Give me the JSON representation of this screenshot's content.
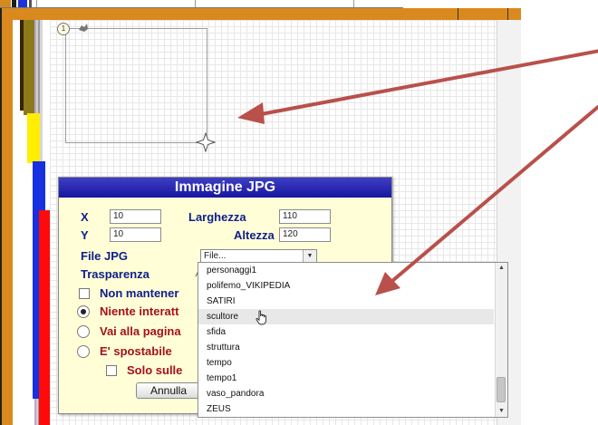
{
  "dialog": {
    "title": "Immagine JPG",
    "x_label": "X",
    "x_value": "10",
    "y_label": "Y",
    "y_value": "10",
    "width_label": "Larghezza",
    "width_value": "110",
    "height_label": "Altezza",
    "height_value": "120",
    "file_label": "File JPG",
    "file_selected": "File...",
    "transparency_label": "Trasparenza",
    "keep_ratio_label": "Non mantener",
    "no_interaction_label": "Niente interatt",
    "goto_page_label": "Vai alla pagina",
    "movable_label": "E' spostabile",
    "only_on_label": "Solo sulle",
    "cancel_label": "Annulla"
  },
  "canvas": {
    "order_badge": "1"
  },
  "dropdown": {
    "options": [
      "personaggi1",
      "polifemo_VIKIPEDIA",
      "SATIRI",
      "scultore",
      "sfida",
      "struttura",
      "tempo",
      "tempo1",
      "vaso_pandora",
      "ZEUS"
    ],
    "highlighted": "scultore"
  },
  "colors": {
    "frame_orange": "#d9891d",
    "title_blue": "#1f1fa8",
    "dialog_bg": "#fffed7",
    "label_blue": "#0e1e8a",
    "label_red": "#a4111c",
    "arrow_red": "#b9504b"
  }
}
